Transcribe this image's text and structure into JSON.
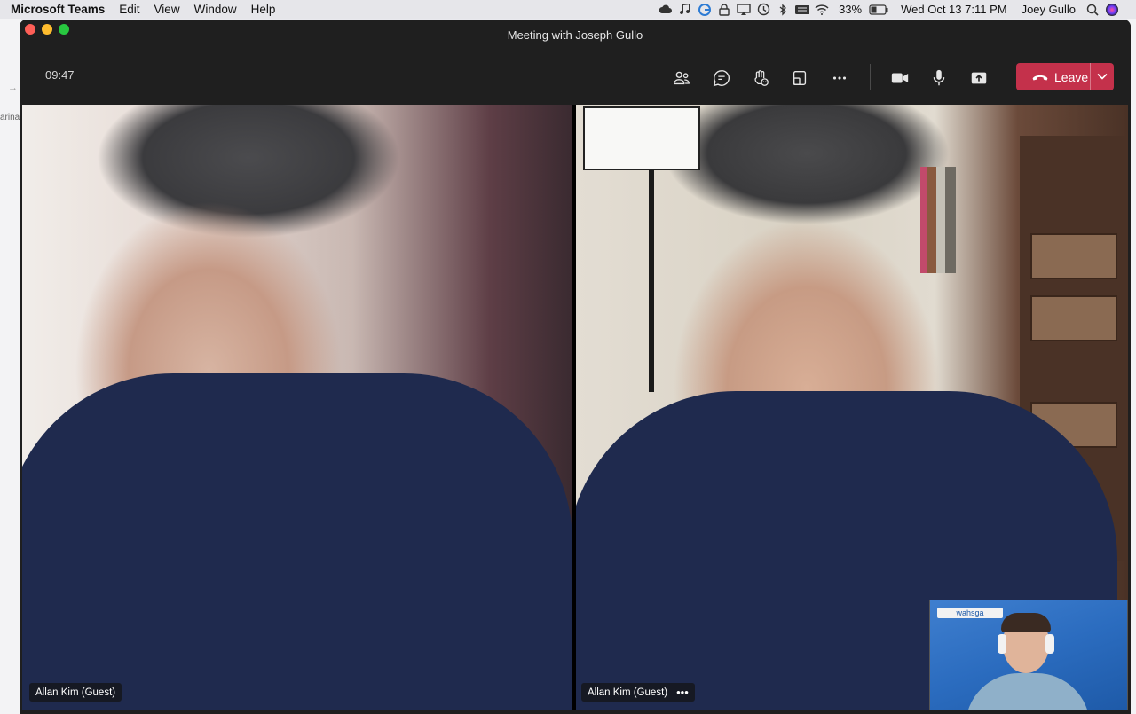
{
  "menubar": {
    "app_name": "Microsoft Teams",
    "menus": [
      "Edit",
      "View",
      "Window",
      "Help"
    ],
    "battery": "33%",
    "datetime": "Wed Oct 13  7:11 PM",
    "user": "Joey Gullo",
    "status_icons": [
      "cloud-icon",
      "music-icon",
      "grammarly-icon",
      "lock-icon",
      "airplay-icon",
      "time-machine-icon",
      "bluetooth-icon",
      "keyboard-icon",
      "wifi-icon",
      "battery-icon",
      "search-icon",
      "siri-icon"
    ]
  },
  "window": {
    "title": "Meeting with Joseph Gullo"
  },
  "controls": {
    "timer": "09:47",
    "buttons": [
      "participants-icon",
      "chat-icon",
      "reactions-icon",
      "rooms-icon",
      "more-icon",
      "camera-icon",
      "mic-icon",
      "share-icon"
    ],
    "leave_label": "Leave",
    "leave_color": "#c4314b"
  },
  "background": {
    "left_fragment": "arina"
  },
  "stage": {
    "tiles": [
      {
        "name": "Allan Kim (Guest)"
      },
      {
        "name": "Allan Kim (Guest)",
        "more": "•••"
      }
    ],
    "self_view_logo": "wahsga"
  }
}
